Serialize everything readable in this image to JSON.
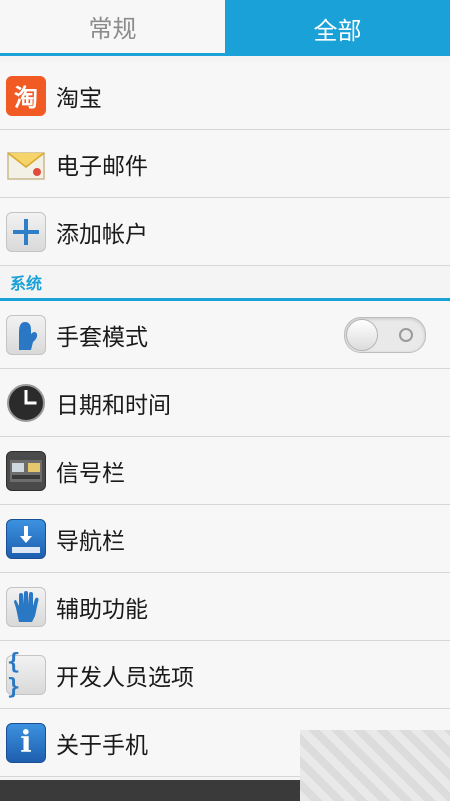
{
  "tabs": [
    {
      "label": "常规",
      "active": false
    },
    {
      "label": "全部",
      "active": true
    }
  ],
  "accounts": [
    {
      "label": "淘宝",
      "icon": "taobao-icon",
      "icon_text": "淘"
    },
    {
      "label": "电子邮件",
      "icon": "email-icon"
    },
    {
      "label": "添加帐户",
      "icon": "plus-icon"
    }
  ],
  "system_section": {
    "title": "系统"
  },
  "system": [
    {
      "label": "手套模式",
      "icon": "glove-icon",
      "toggle": "off"
    },
    {
      "label": "日期和时间",
      "icon": "clock-icon"
    },
    {
      "label": "信号栏",
      "icon": "signal-bar-icon"
    },
    {
      "label": "导航栏",
      "icon": "navigation-bar-icon"
    },
    {
      "label": "辅助功能",
      "icon": "hand-icon"
    },
    {
      "label": "开发人员选项",
      "icon": "braces-icon",
      "icon_text": "{ }"
    },
    {
      "label": "关于手机",
      "icon": "info-icon",
      "icon_text": "i"
    }
  ],
  "colors": {
    "accent": "#1aa1d7",
    "taobao": "#f15a22"
  }
}
